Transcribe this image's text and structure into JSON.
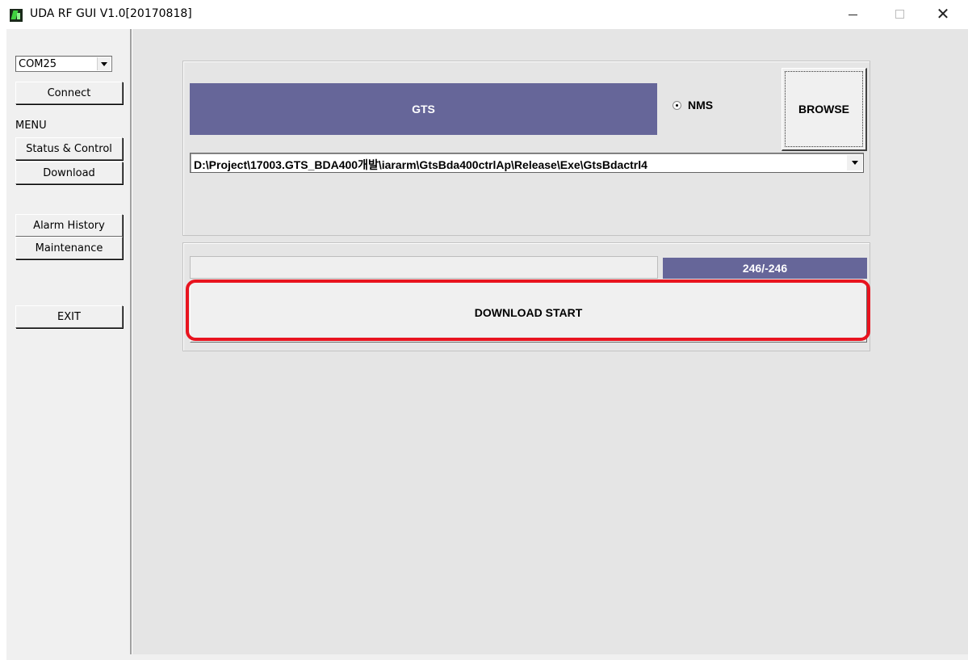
{
  "window": {
    "title": "UDA RF GUI V1.0[20170818]"
  },
  "sidebar": {
    "port_select": {
      "value": "COM25"
    },
    "connect_label": "Connect",
    "menu_label": "MENU",
    "items": [
      {
        "label": "Status & Control"
      },
      {
        "label": "Download",
        "selected": true
      },
      {
        "label": "Alarm History"
      },
      {
        "label": "Maintenance"
      }
    ],
    "exit_label": "EXIT"
  },
  "download": {
    "target_label": "GTS",
    "radio_label": "NMS",
    "radio_checked": true,
    "browse_label": "BROWSE",
    "file_path": "D:\\Project\\17003.GTS_BDA400개발\\iararm\\GtsBda400ctrlAp\\Release\\Exe\\GtsBdactrl4",
    "progress_fraction": 0,
    "count_text": "246/-246",
    "start_label": "DOWNLOAD START"
  },
  "colors": {
    "panel_accent": "#666699",
    "highlight": "#e8141f"
  }
}
